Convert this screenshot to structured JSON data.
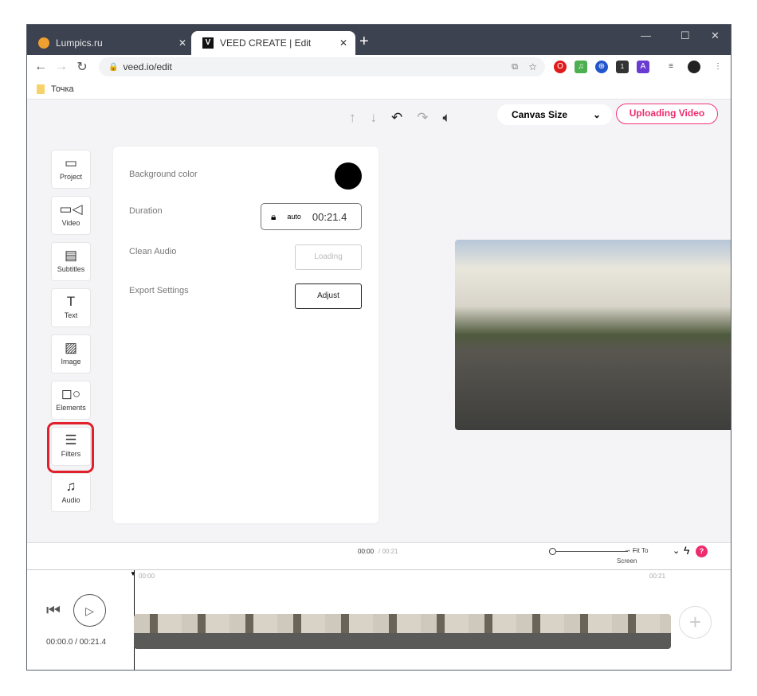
{
  "browser": {
    "tabs": [
      {
        "title": "Lumpics.ru"
      },
      {
        "title": "VEED CREATE | Edit",
        "favicon": "V"
      }
    ],
    "url": "veed.io/edit",
    "bookmark": "Точка",
    "ext_badge": "1"
  },
  "toolbar": {
    "canvas_size": "Canvas Size",
    "uploading": "Uploading Video"
  },
  "sidebar": {
    "items": [
      {
        "label": "Project",
        "icon": "▭"
      },
      {
        "label": "Video",
        "icon": "▭◁"
      },
      {
        "label": "Subtitles",
        "icon": "▤"
      },
      {
        "label": "Text",
        "icon": "T"
      },
      {
        "label": "Image",
        "icon": "▨"
      },
      {
        "label": "Elements",
        "icon": "◻○"
      },
      {
        "label": "Filters",
        "icon": "☰"
      },
      {
        "label": "Audio",
        "icon": "♫"
      }
    ]
  },
  "panel": {
    "background_color": "Background color",
    "bg_value": "#000000",
    "duration": "Duration",
    "duration_mode": "auto",
    "duration_value": "00:21.4",
    "clean_audio": "Clean Audio",
    "loading": "Loading",
    "export_settings": "Export Settings",
    "adjust": "Adjust"
  },
  "timeline": {
    "current": "00:00",
    "total": "/ 00:21",
    "fit": "Fit To",
    "fit2": "Screen",
    "help": "?",
    "ruler_start": "00:00",
    "ruler_end": "00:21",
    "player_time": "00:00.0 / 00:21.4"
  }
}
